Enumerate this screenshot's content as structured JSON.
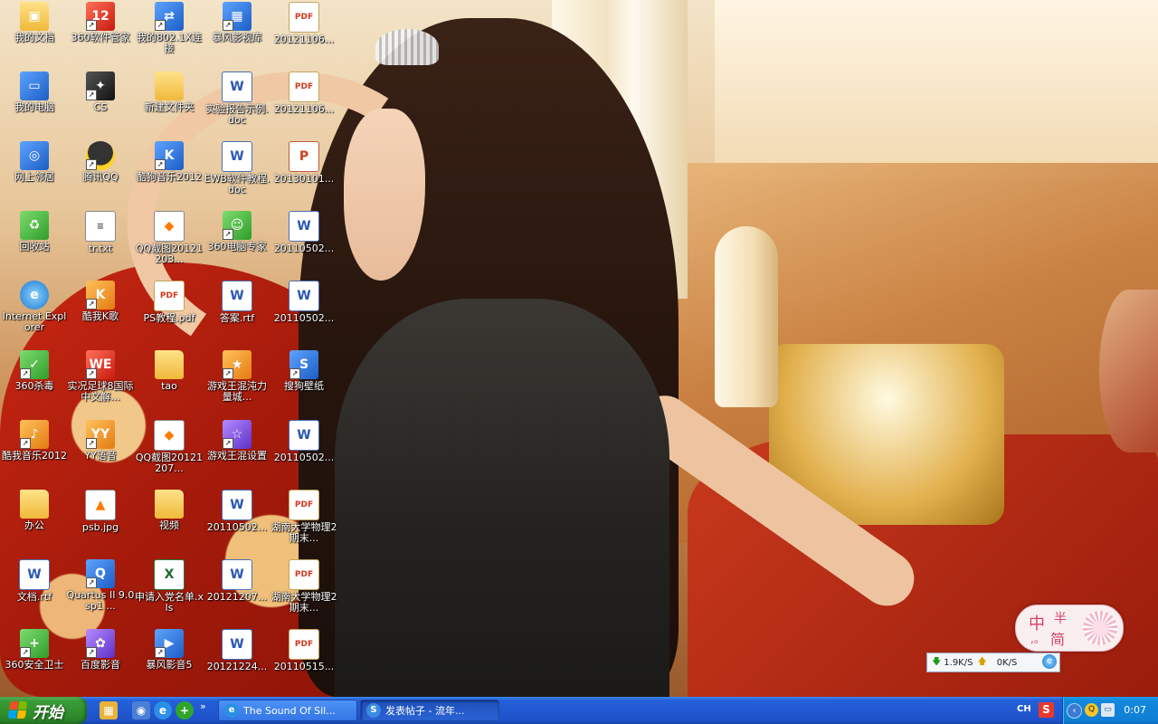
{
  "desktop": {
    "icons": [
      {
        "label": "我的文档",
        "icon": "my-documents-icon",
        "glyph": "▣",
        "type": "folder",
        "shortcut": false
      },
      {
        "label": "我的电脑",
        "icon": "my-computer-icon",
        "glyph": "▭",
        "type": "app",
        "shortcut": false
      },
      {
        "label": "网上邻居",
        "icon": "network-places-icon",
        "glyph": "◎",
        "type": "app",
        "shortcut": false
      },
      {
        "label": "回收站",
        "icon": "recycle-bin-icon",
        "glyph": "♻",
        "type": "green",
        "shortcut": false
      },
      {
        "label": "Internet Explorer",
        "icon": "internet-explorer-icon",
        "glyph": "e",
        "type": "ie",
        "shortcut": false
      },
      {
        "label": "360杀毒",
        "icon": "360-antivirus-icon",
        "glyph": "✓",
        "type": "green",
        "shortcut": true
      },
      {
        "label": "酷我音乐2012",
        "icon": "kuwo-music-icon",
        "glyph": "♪",
        "type": "orange",
        "shortcut": true
      },
      {
        "label": "办公",
        "icon": "folder-icon",
        "glyph": "",
        "type": "folder",
        "shortcut": false
      },
      {
        "label": "文档.rtf",
        "icon": "word-document-icon",
        "glyph": "W",
        "type": "word",
        "shortcut": false
      },
      {
        "label": "360安全卫士",
        "icon": "360-safeguard-icon",
        "glyph": "+",
        "type": "green",
        "shortcut": true
      },
      {
        "label": "360软件管家",
        "icon": "360-software-manager-icon",
        "glyph": "12",
        "type": "red",
        "shortcut": true
      },
      {
        "label": "CS",
        "icon": "counter-strike-icon",
        "glyph": "✦",
        "type": "dark",
        "shortcut": true
      },
      {
        "label": "腾讯QQ",
        "icon": "qq-penguin-icon",
        "glyph": "",
        "type": "qq",
        "shortcut": true
      },
      {
        "label": "tr.txt",
        "icon": "text-file-icon",
        "glyph": "≡",
        "type": "txt",
        "shortcut": false
      },
      {
        "label": "酷我K歌",
        "icon": "kuwo-karaoke-icon",
        "glyph": "K",
        "type": "orange",
        "shortcut": true
      },
      {
        "label": "实况足球8国际中文解...",
        "icon": "winning-eleven-icon",
        "glyph": "WE",
        "type": "red",
        "shortcut": true
      },
      {
        "label": "YY语音",
        "icon": "yy-voice-icon",
        "glyph": "YY",
        "type": "orange",
        "shortcut": true
      },
      {
        "label": "psb.jpg",
        "icon": "image-file-icon",
        "glyph": "▲",
        "type": "pic",
        "shortcut": false
      },
      {
        "label": "Quartus II 9.0sp1 ...",
        "icon": "quartus-icon",
        "glyph": "Q",
        "type": "app",
        "shortcut": true
      },
      {
        "label": "百度影音",
        "icon": "baidu-player-icon",
        "glyph": "✿",
        "type": "purple",
        "shortcut": true
      },
      {
        "label": "我的802.1X连接",
        "icon": "network-connection-icon",
        "glyph": "⇄",
        "type": "app",
        "shortcut": true
      },
      {
        "label": "新建文件夹",
        "icon": "folder-icon",
        "glyph": "",
        "type": "folder",
        "shortcut": false
      },
      {
        "label": "酷狗音乐2012",
        "icon": "kugou-music-icon",
        "glyph": "K",
        "type": "app",
        "shortcut": true
      },
      {
        "label": "QQ截图20121203...",
        "icon": "image-file-icon",
        "glyph": "◆",
        "type": "pic",
        "shortcut": false
      },
      {
        "label": "PS教程.pdf",
        "icon": "pdf-file-icon",
        "glyph": "PDF",
        "type": "pdf",
        "shortcut": false
      },
      {
        "label": "tao",
        "icon": "folder-icon",
        "glyph": "",
        "type": "folder",
        "shortcut": false
      },
      {
        "label": "QQ截图20121207...",
        "icon": "image-file-icon",
        "glyph": "◆",
        "type": "pic",
        "shortcut": false
      },
      {
        "label": "视频",
        "icon": "folder-icon",
        "glyph": "",
        "type": "folder",
        "shortcut": false
      },
      {
        "label": "申请入党名单.xls",
        "icon": "excel-file-icon",
        "glyph": "X",
        "type": "xls",
        "shortcut": false
      },
      {
        "label": "暴风影音5",
        "icon": "storm-player-icon",
        "glyph": "▶",
        "type": "app",
        "shortcut": true
      },
      {
        "label": "暴风影视库",
        "icon": "storm-video-library-icon",
        "glyph": "▦",
        "type": "app",
        "shortcut": true
      },
      {
        "label": "实验报告示例.doc",
        "icon": "word-document-icon",
        "glyph": "W",
        "type": "word",
        "shortcut": false
      },
      {
        "label": "EWB软件教程.doc",
        "icon": "word-document-icon",
        "glyph": "W",
        "type": "word",
        "shortcut": false
      },
      {
        "label": "360电脑专家",
        "icon": "360-pc-expert-icon",
        "glyph": "☺",
        "type": "green",
        "shortcut": true
      },
      {
        "label": "答案.rtf",
        "icon": "word-document-icon",
        "glyph": "W",
        "type": "word",
        "shortcut": false
      },
      {
        "label": "游戏王混沌力量城...",
        "icon": "yugioh-game-icon",
        "glyph": "★",
        "type": "orange",
        "shortcut": true
      },
      {
        "label": "游戏王混设置",
        "icon": "yugioh-settings-icon",
        "glyph": "☆",
        "type": "purple",
        "shortcut": true
      },
      {
        "label": "20110502...",
        "icon": "word-document-icon",
        "glyph": "W",
        "type": "word",
        "shortcut": false
      },
      {
        "label": "20121207...",
        "icon": "word-document-icon",
        "glyph": "W",
        "type": "word",
        "shortcut": false
      },
      {
        "label": "20121224...",
        "icon": "word-document-icon",
        "glyph": "W",
        "type": "word",
        "shortcut": false
      },
      {
        "label": "20121106...",
        "icon": "pdf-file-icon",
        "glyph": "PDF",
        "type": "pdf",
        "shortcut": false
      },
      {
        "label": "20121106...",
        "icon": "pdf-file-icon",
        "glyph": "PDF",
        "type": "pdf",
        "shortcut": false
      },
      {
        "label": "20130101...",
        "icon": "powerpoint-file-icon",
        "glyph": "P",
        "type": "ppt",
        "shortcut": false
      },
      {
        "label": "20110502...",
        "icon": "word-document-icon",
        "glyph": "W",
        "type": "word",
        "shortcut": false
      },
      {
        "label": "20110502...",
        "icon": "word-document-icon",
        "glyph": "W",
        "type": "word",
        "shortcut": false
      },
      {
        "label": "搜狗壁纸",
        "icon": "sogou-wallpaper-icon",
        "glyph": "S",
        "type": "app",
        "shortcut": true
      },
      {
        "label": "20110502...",
        "icon": "word-document-icon",
        "glyph": "W",
        "type": "word",
        "shortcut": false
      },
      {
        "label": "湖南大学物理2期末...",
        "icon": "pdf-file-icon",
        "glyph": "PDF",
        "type": "pdf",
        "shortcut": false
      },
      {
        "label": "湖南大学物理2期末...",
        "icon": "pdf-file-icon",
        "glyph": "PDF",
        "type": "pdf",
        "shortcut": false
      },
      {
        "label": "20110515...",
        "icon": "pdf-file-icon",
        "glyph": "PDF",
        "type": "pdf",
        "shortcut": false
      }
    ]
  },
  "ime_widget": {
    "char1": "中",
    "char2": "半",
    "char3": "简",
    "punct": ",。"
  },
  "net_monitor": {
    "download": "1.9K/S",
    "upload": "0K/S",
    "download_icon": "down-arrow-icon",
    "upload_icon": "up-arrow-icon"
  },
  "taskbar": {
    "start_label": "开始",
    "quick_launch": [
      {
        "icon": "show-desktop-icon",
        "glyph": "▦"
      },
      {
        "icon": "media-player-icon",
        "glyph": "◉"
      },
      {
        "icon": "internet-explorer-icon",
        "glyph": "e"
      },
      {
        "icon": "360-safeguard-icon",
        "glyph": "+"
      }
    ],
    "more": "»",
    "tasks": [
      {
        "label": "The Sound Of Sil...",
        "icon": "internet-explorer-icon",
        "glyph": "e",
        "active": false
      },
      {
        "label": "发表帖子 - 流年...",
        "icon": "sogou-browser-icon",
        "glyph": "S",
        "active": true
      }
    ],
    "language": "CH",
    "tray_icons": [
      "qq-tray-icon",
      "network-tray-icon"
    ],
    "clock": "0:07"
  }
}
